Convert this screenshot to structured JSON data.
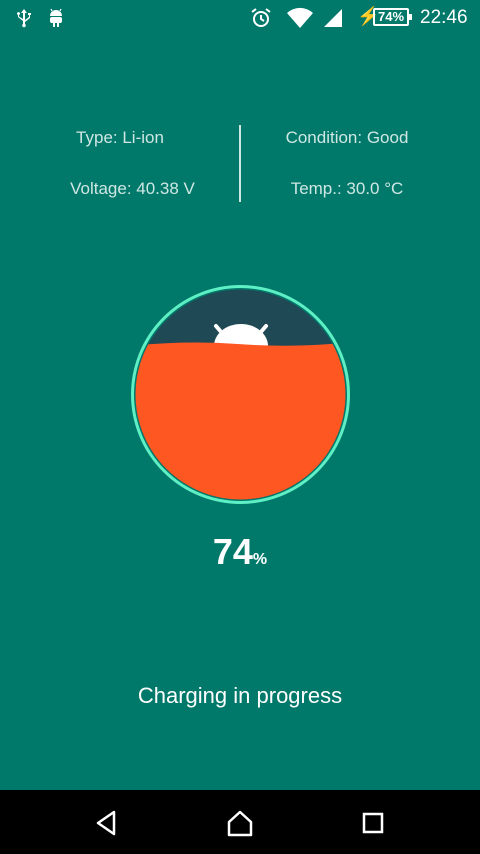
{
  "status_bar": {
    "left_icons": [
      "usb-icon",
      "android-icon"
    ],
    "right_icons": [
      "alarm-icon",
      "wifi-icon",
      "signal-icon",
      "charging-bolt-icon"
    ],
    "battery_label": "74%",
    "time": "22:46"
  },
  "battery_info": {
    "type": "Type: Li-ion",
    "voltage": "Voltage: 40.38 V",
    "condition": "Condition: Good",
    "temperature": "Temp.: 30.0 °C"
  },
  "gauge": {
    "level_percent": 74,
    "fill_color": "#ff5722",
    "empty_color": "#1f4a55",
    "ring_color": "#5ef0c4"
  },
  "percent_display": {
    "value": "74",
    "unit": "%"
  },
  "status_text": "Charging in progress",
  "nav_bar": {
    "buttons": [
      "back-icon",
      "home-icon",
      "recents-icon"
    ]
  },
  "colors": {
    "background": "#00796b",
    "nav_background": "#000000"
  }
}
